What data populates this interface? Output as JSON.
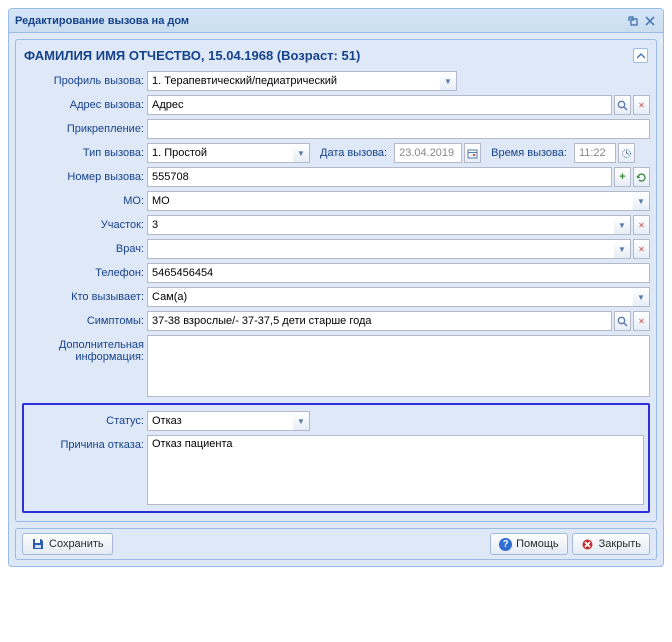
{
  "window": {
    "title": "Редактирование вызова на дом"
  },
  "patient_header": "ФАМИЛИЯ ИМЯ ОТЧЕСТВО, 15.04.1968 (Возраст: 51)",
  "labels": {
    "profile": "Профиль вызова:",
    "address": "Адрес вызова:",
    "attachment": "Прикрепление:",
    "call_type": "Тип вызова:",
    "call_date": "Дата вызова:",
    "call_time": "Время вызова:",
    "call_number": "Номер вызова:",
    "mo": "МО:",
    "uchastok": "Участок:",
    "doctor": "Врач:",
    "phone": "Телефон:",
    "caller": "Кто вызывает:",
    "symptoms": "Симптомы:",
    "extra": "Дополнительная\nинформация:",
    "status": "Статус:",
    "refusal_reason": "Причина отказа:"
  },
  "values": {
    "profile": "1. Терапевтический/педиатрический",
    "address": "Адрес",
    "attachment": "",
    "call_type": "1. Простой",
    "call_date": "23.04.2019",
    "call_time": "11:22",
    "call_number": "555708",
    "mo": "МО",
    "uchastok": "3",
    "doctor": "",
    "phone": "5465456454",
    "caller": "Сам(а)",
    "symptoms": "37-38 взрослые/- 37-37,5 дети старше года",
    "extra": "",
    "status": "Отказ",
    "refusal_reason": "Отказ пациента"
  },
  "buttons": {
    "save": "Сохранить",
    "help": "Помощь",
    "close": "Закрыть"
  }
}
